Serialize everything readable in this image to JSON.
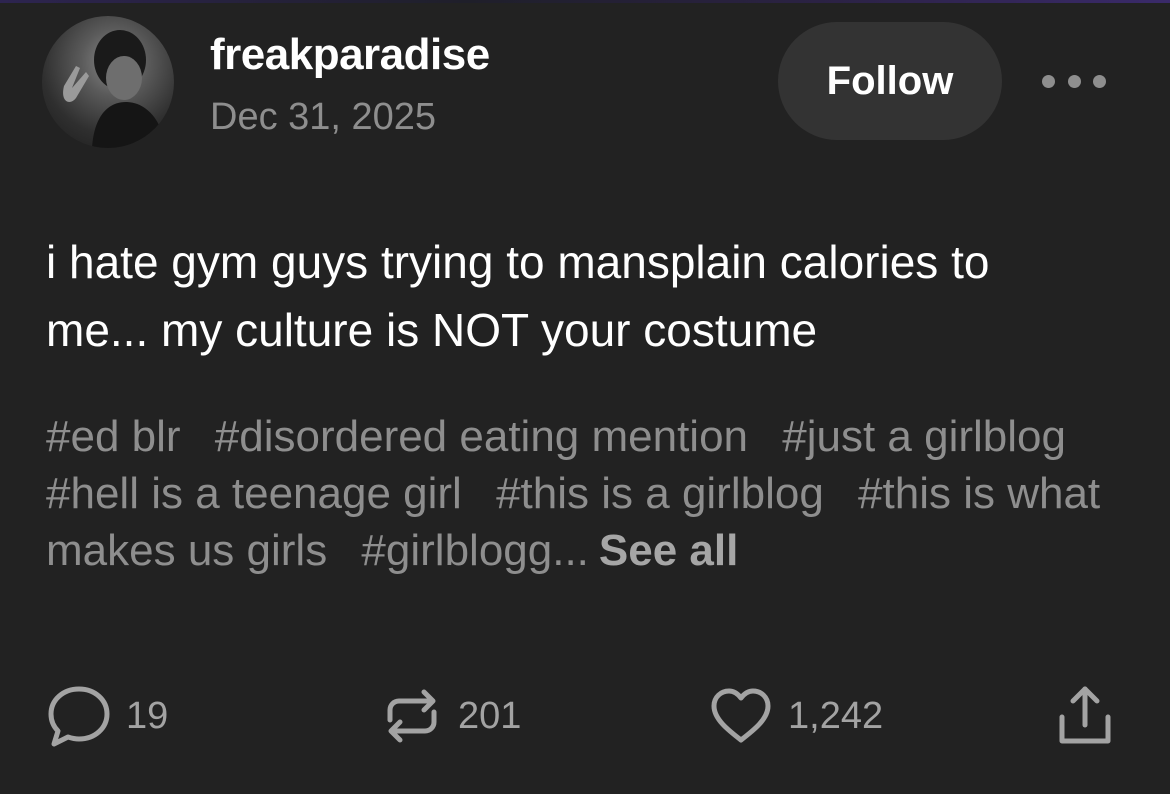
{
  "post": {
    "username": "freakparadise",
    "date": "Dec 31, 2025",
    "follow_label": "Follow",
    "more_icon": "ellipsis-icon",
    "body_lines": [
      "i hate gym guys trying to mansplain calories to",
      "me... my culture is NOT your costume"
    ],
    "tags": [
      "#ed blr",
      "#disordered eating mention",
      "#just a girlblog",
      "#hell is a teenage girl",
      "#this is a girlblog",
      "#this is what makes us girls",
      "#girlblogg..."
    ],
    "see_all_label": "See all"
  },
  "actions": {
    "comments": {
      "icon": "comment-icon",
      "count": "19"
    },
    "reblogs": {
      "icon": "reblog-icon",
      "count": "201"
    },
    "likes": {
      "icon": "heart-icon",
      "count": "1,242"
    },
    "share": {
      "icon": "share-icon"
    }
  },
  "colors": {
    "background": "#222222",
    "text": "#ffffff",
    "muted": "#8e8e8e",
    "button": "#333333"
  }
}
